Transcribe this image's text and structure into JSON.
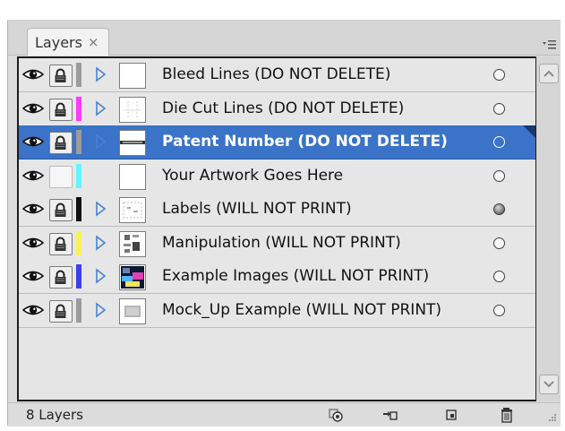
{
  "panel": {
    "tab_label": "Layers",
    "tab_close_glyph": "×",
    "menu_icon": "panel-menu-icon"
  },
  "layers": [
    {
      "name": "Bleed Lines (DO NOT DELETE)",
      "visible": true,
      "locked": true,
      "color": "#9c9c9c",
      "has_children": true,
      "selected": false,
      "target": "empty",
      "thumb": "blank"
    },
    {
      "name": "Die Cut Lines (DO NOT DELETE)",
      "visible": true,
      "locked": true,
      "color": "#ff3cf5",
      "has_children": true,
      "selected": false,
      "target": "empty",
      "thumb": "dieline"
    },
    {
      "name": "Patent Number (DO NOT DELETE)",
      "visible": true,
      "locked": true,
      "color": "#9c9c9c",
      "has_children": true,
      "selected": true,
      "target": "empty",
      "thumb": "patent"
    },
    {
      "name": "Your Artwork Goes Here",
      "visible": true,
      "locked": false,
      "color": "#66f4ff",
      "has_children": false,
      "selected": false,
      "target": "empty",
      "thumb": "blank"
    },
    {
      "name": "Labels (WILL NOT PRINT)",
      "visible": true,
      "locked": true,
      "color": "#111111",
      "has_children": true,
      "selected": false,
      "target": "filled",
      "thumb": "labels"
    },
    {
      "name": "Manipulation (WILL NOT PRINT)",
      "visible": true,
      "locked": true,
      "color": "#f7f25c",
      "has_children": true,
      "selected": false,
      "target": "empty",
      "thumb": "manip"
    },
    {
      "name": "Example Images (WILL NOT PRINT)",
      "visible": true,
      "locked": true,
      "color": "#3b3ff0",
      "has_children": true,
      "selected": false,
      "target": "empty",
      "thumb": "images"
    },
    {
      "name": "Mock_Up Example (WILL NOT PRINT)",
      "visible": true,
      "locked": true,
      "color": "#9c9c9c",
      "has_children": true,
      "selected": false,
      "target": "empty",
      "thumb": "mockup"
    }
  ],
  "status": {
    "layer_count": "8 Layers"
  },
  "bottom_buttons": [
    {
      "icon": "make-clipping-mask-icon"
    },
    {
      "icon": "create-new-sublayer-icon"
    },
    {
      "icon": "create-new-layer-icon"
    },
    {
      "icon": "delete-layer-icon"
    }
  ],
  "colors": {
    "selection": "#3a73c7",
    "panel_bg": "#dcdcdc",
    "row_bg": "#e6e6e6"
  }
}
